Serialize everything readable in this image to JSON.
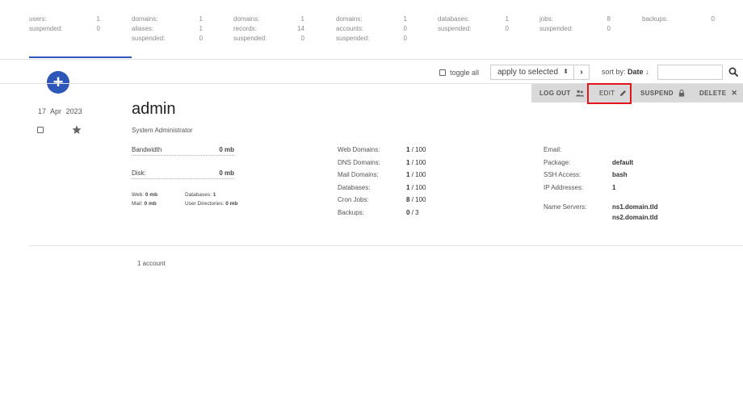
{
  "stats": [
    {
      "rows": [
        {
          "k": "users:",
          "v": "1"
        },
        {
          "k": "suspended:",
          "v": "0"
        }
      ]
    },
    {
      "rows": [
        {
          "k": "domains:",
          "v": "1"
        },
        {
          "k": "aliases:",
          "v": "1"
        },
        {
          "k": "suspended:",
          "v": "0"
        }
      ]
    },
    {
      "rows": [
        {
          "k": "domains:",
          "v": "1"
        },
        {
          "k": "records:",
          "v": "14"
        },
        {
          "k": "suspended:",
          "v": "0"
        }
      ]
    },
    {
      "rows": [
        {
          "k": "domains:",
          "v": "1"
        },
        {
          "k": "accounts:",
          "v": "0"
        },
        {
          "k": "suspended:",
          "v": "0"
        }
      ]
    },
    {
      "rows": [
        {
          "k": "databases:",
          "v": "1"
        },
        {
          "k": "suspended:",
          "v": "0"
        }
      ]
    },
    {
      "rows": [
        {
          "k": "jobs:",
          "v": "8"
        },
        {
          "k": "suspended:",
          "v": "0"
        }
      ]
    },
    {
      "rows": [
        {
          "k": "backups:",
          "v": "0"
        }
      ]
    }
  ],
  "add_button": {
    "symbol": "+"
  },
  "toolbar": {
    "toggle_all_label": "toggle all",
    "apply_label": "apply to selected",
    "apply_arrow": "⬍",
    "go_label": "›",
    "sort_label": "sort by:",
    "sort_value": "Date",
    "sort_arrow": "↓",
    "search_placeholder": "",
    "search_value": ""
  },
  "actions": {
    "logout_label": "LOG OUT",
    "edit_label": "EDIT",
    "suspend_label": "SUSPEND",
    "delete_label": "DELETE",
    "delete_icon": "✕"
  },
  "user": {
    "date_day": "17",
    "date_month": "Apr",
    "date_year": "2023",
    "username": "admin",
    "fullname": "System Administrator",
    "bandwidth_label": "Bandwidth",
    "bandwidth_value": "0",
    "bandwidth_unit": "mb",
    "disk_label": "Disk:",
    "disk_value": "0",
    "disk_unit": "mb",
    "web_label": "Web:",
    "web_value": "0 mb",
    "mail_label": "Mail:",
    "mail_value": "0 mb",
    "databases_label": "Databases:",
    "databases_value": "1",
    "userdirs_label": "User Directories:",
    "userdirs_value": "0 mb"
  },
  "limits": [
    {
      "label": "Web Domains:",
      "used": "1",
      "total": "/ 100"
    },
    {
      "label": "DNS Domains:",
      "used": "1",
      "total": "/ 100"
    },
    {
      "label": "Mail Domains:",
      "used": "1",
      "total": "/ 100"
    },
    {
      "label": "Databases:",
      "used": "1",
      "total": "/ 100"
    },
    {
      "label": "Cron Jobs:",
      "used": "8",
      "total": "/ 100"
    },
    {
      "label": "Backups:",
      "used": "0",
      "total": "/ 3"
    }
  ],
  "details": {
    "email_label": "Email:",
    "email_value": "",
    "package_label": "Package:",
    "package_value": "default",
    "ssh_label": "SSH Access:",
    "ssh_value": "bash",
    "ip_label": "IP Addresses:",
    "ip_value": "1",
    "ns_label": "Name Servers:",
    "ns1": "ns1.domain.tld",
    "ns2": "ns2.domain.tld"
  },
  "footer": {
    "count": "1 account"
  },
  "colors": {
    "accent": "#2c56b8",
    "highlight": "#e0161c",
    "action_bar": "#d9d9d9"
  }
}
